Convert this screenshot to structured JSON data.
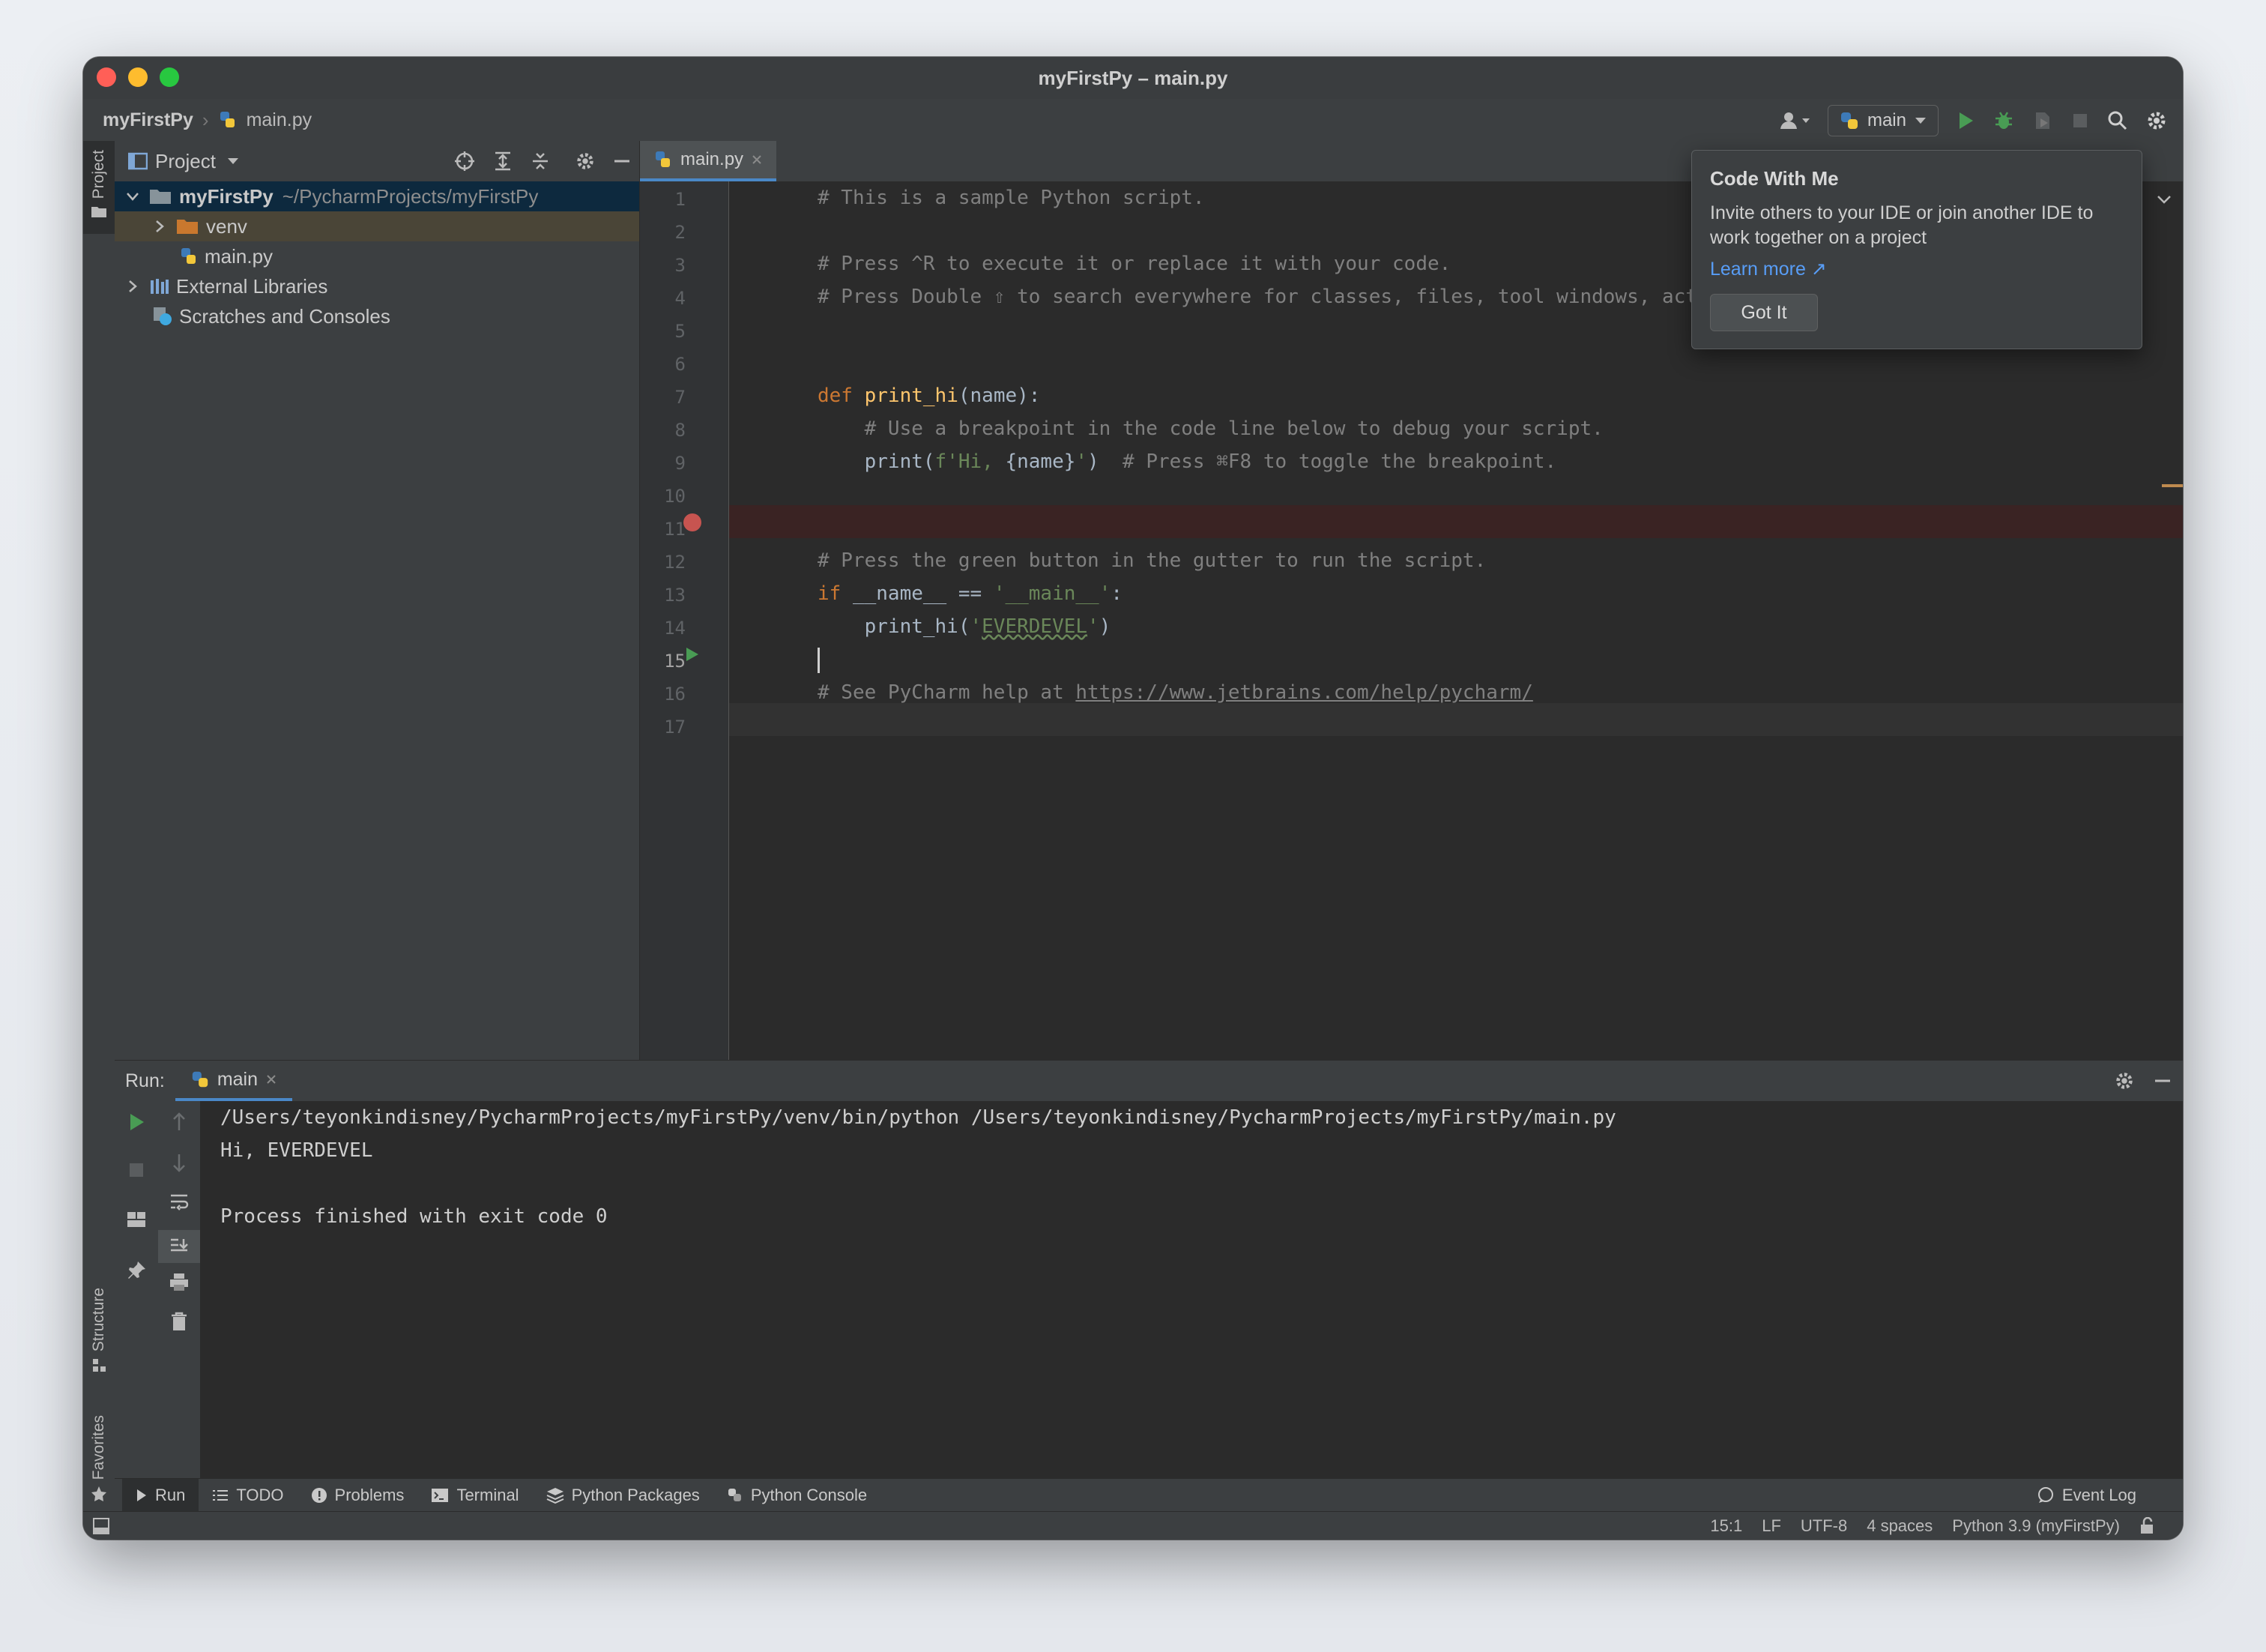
{
  "window": {
    "title": "myFirstPy – main.py"
  },
  "navbar": {
    "project": "myFirstPy",
    "file": "main.py",
    "run_config": "main"
  },
  "project_panel": {
    "title": "Project",
    "side_tab": "Project",
    "tree": [
      {
        "label": "myFirstPy",
        "path": "~/PycharmProjects/myFirstPy"
      },
      {
        "label": "venv"
      },
      {
        "label": "main.py"
      },
      {
        "label": "External Libraries"
      },
      {
        "label": "Scratches and Consoles"
      }
    ]
  },
  "editor": {
    "tab_label": "main.py",
    "line_numbers": [
      "1",
      "2",
      "3",
      "4",
      "5",
      "6",
      "7",
      "8",
      "9",
      "10",
      "11",
      "12",
      "13",
      "14",
      "15",
      "16",
      "17"
    ],
    "lines": {
      "l1": "# This is a sample Python script.",
      "l3": "# Press ^R to execute it or replace it with your code.",
      "l4": "# Press Double ⇧ to search everywhere for classes, files, tool windows, actions,",
      "l7_kw": "def ",
      "l7_fn": "print_hi",
      "l7_rest": "(name):",
      "l8": "    # Use a breakpoint in the code line below to debug your script.",
      "l9_a": "    print(",
      "l9_str1": "f'Hi, ",
      "l9_var": "{name}",
      "l9_str2": "'",
      "l9_b": ")  ",
      "l9_com": "# Press ⌘F8 to toggle the breakpoint.",
      "l12": "# Press the green button in the gutter to run the script.",
      "l13_kw": "if ",
      "l13_a": "__name__ == ",
      "l13_str": "'__main__'",
      "l13_b": ":",
      "l14_a": "    print_hi(",
      "l14_str1": "'",
      "l14_word": "EVERDEVEL",
      "l14_str2": "'",
      "l14_b": ")",
      "l16_a": "# See PyCharm help at ",
      "l16_link": "https://www.jetbrains.com/help/pycharm/"
    }
  },
  "popup": {
    "title": "Code With Me",
    "body": "Invite others to your IDE or join another IDE to work together on a project",
    "link": "Learn more ↗",
    "button": "Got It"
  },
  "run_panel": {
    "label": "Run:",
    "tab": "main",
    "output": [
      "/Users/teyonkindisney/PycharmProjects/myFirstPy/venv/bin/python /Users/teyonkindisney/PycharmProjects/myFirstPy/main.py",
      "Hi, EVERDEVEL",
      "",
      "Process finished with exit code 0"
    ]
  },
  "side_tabs": {
    "structure": "Structure",
    "favorites": "Favorites"
  },
  "bottom_tools": [
    "Run",
    "TODO",
    "Problems",
    "Terminal",
    "Python Packages",
    "Python Console"
  ],
  "event_log": "Event Log",
  "status": {
    "position": "15:1",
    "line_sep": "LF",
    "encoding": "UTF-8",
    "indent": "4 spaces",
    "interpreter": "Python 3.9 (myFirstPy)"
  },
  "colors": {
    "accent": "#4a88c7",
    "breakpoint": "#c75450",
    "run_green": "#499c54"
  }
}
